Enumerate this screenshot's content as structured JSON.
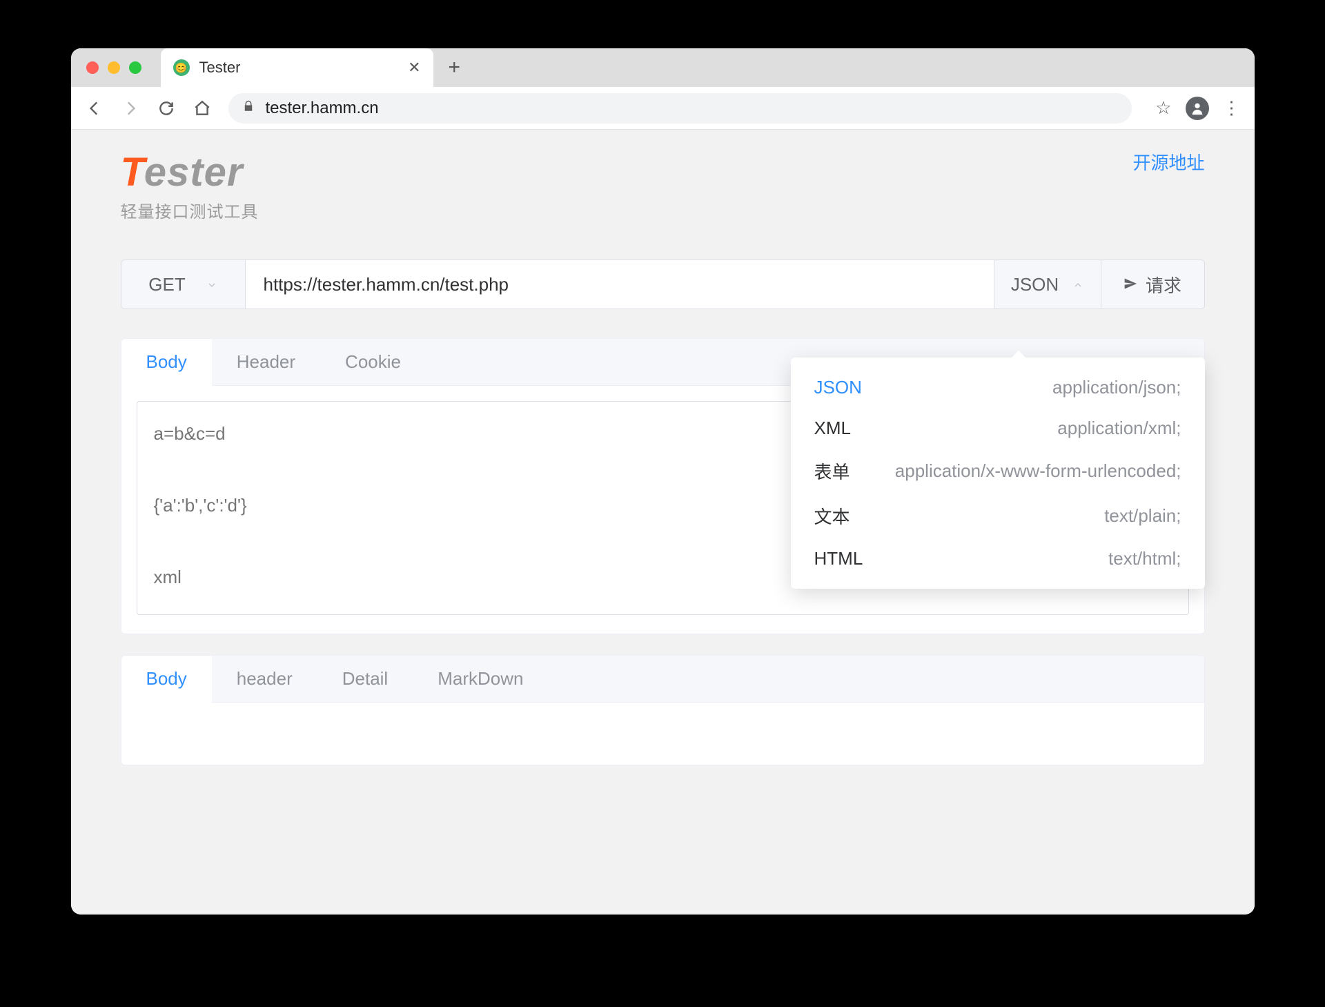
{
  "browser": {
    "tab_title": "Tester",
    "url": "tester.hamm.cn"
  },
  "header": {
    "logo_first": "T",
    "logo_rest": "ester",
    "subtitle": "轻量接口测试工具",
    "source_link": "开源地址"
  },
  "request_bar": {
    "method": "GET",
    "url": "https://tester.hamm.cn/test.php",
    "content_type": "JSON",
    "send_label": "请求"
  },
  "request_tabs": [
    "Body",
    "Header",
    "Cookie"
  ],
  "body_placeholder": "a=b&c=d\n\n{'a':'b','c':'d'}\n\nxml",
  "response_tabs": [
    "Body",
    "header",
    "Detail",
    "MarkDown"
  ],
  "content_type_dropdown": [
    {
      "name": "JSON",
      "mime": "application/json;"
    },
    {
      "name": "XML",
      "mime": "application/xml;"
    },
    {
      "name": "表单",
      "mime": "application/x-www-form-urlencoded;"
    },
    {
      "name": "文本",
      "mime": "text/plain;"
    },
    {
      "name": "HTML",
      "mime": "text/html;"
    }
  ]
}
